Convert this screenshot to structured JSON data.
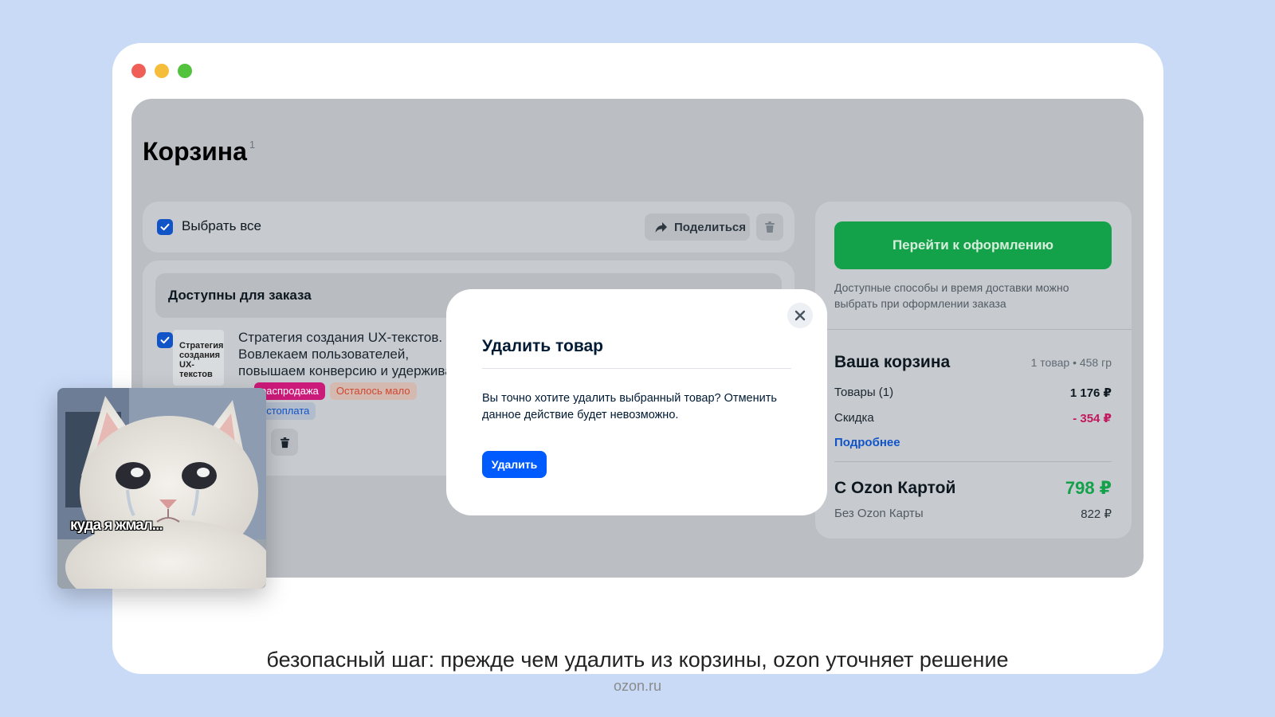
{
  "cart": {
    "title": "Корзина",
    "count": "1",
    "select_all": "Выбрать все",
    "share_label": "Поделиться",
    "available_heading": "Доступны для заказа",
    "item": {
      "title_lines": [
        "Стратегия создания UX-текстов.",
        "Вовлекаем пользователей,",
        "повышаем конверсию и удерживаем"
      ],
      "cover_text": [
        "Стратегия",
        "создания",
        "UX-текстов"
      ],
      "badge_sale": "распродажа",
      "badge_low": "Осталось мало",
      "badge_payment": "остоплата"
    }
  },
  "summary": {
    "checkout_label": "Перейти к оформлению",
    "delivery_note": "Доступные способы и время доставки можно выбрать при оформлении заказа",
    "cart_title": "Ваша корзина",
    "cart_meta": "1 товар • 458 гр",
    "goods_label": "Товары (1)",
    "goods_value": "1 176 ₽",
    "discount_label": "Скидка",
    "discount_value": "- 354 ₽",
    "more_link": "Подробнее",
    "ozon_card_label": "С Ozon Картой",
    "ozon_card_price": "798 ₽",
    "no_card_label": "Без Ozon Карты",
    "no_card_price": "822 ₽"
  },
  "modal": {
    "title": "Удалить товар",
    "text": "Вы точно хотите удалить выбранный товар? Отменить данное действие будет невозможно.",
    "delete_label": "Удалить"
  },
  "meme": {
    "caption": "куда я жмал..."
  },
  "footer": {
    "caption": "безопасный шаг: прежде чем удалить из корзины, ozon уточняет решение",
    "source": "ozon.ru"
  },
  "colors": {
    "page_bg": "#c9daf7",
    "checkout_green": "#13a14a",
    "primary_blue": "#005bff",
    "discount_pink": "#c3185f"
  }
}
